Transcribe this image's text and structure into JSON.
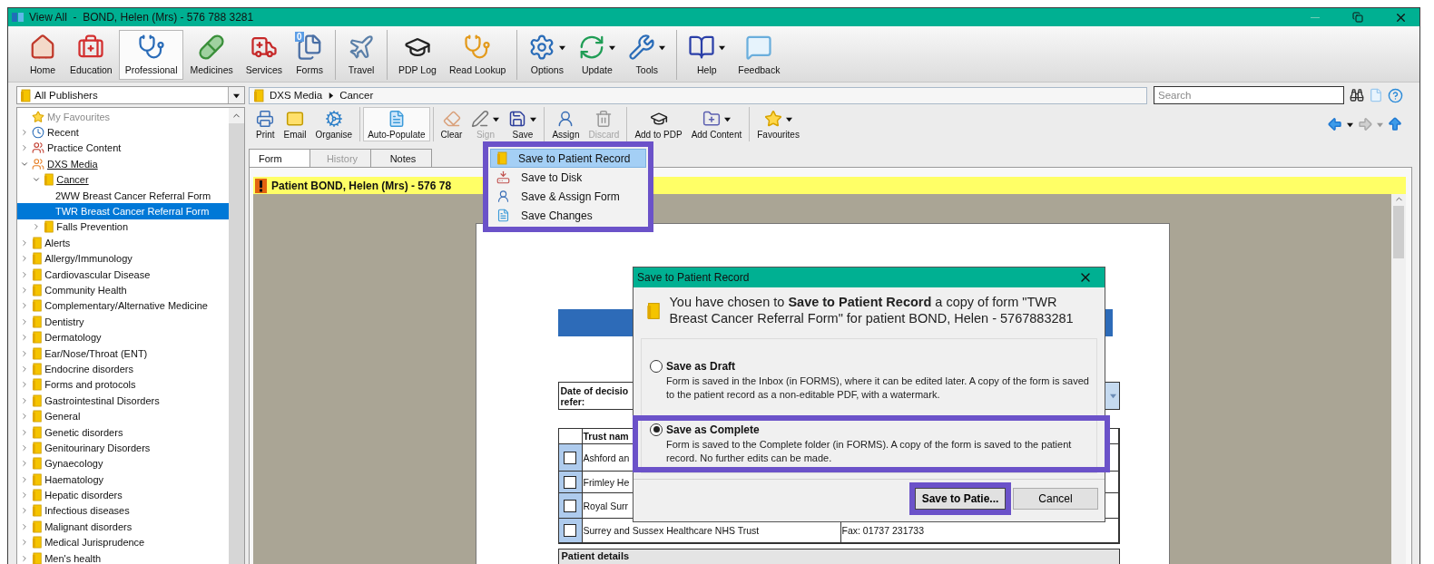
{
  "window": {
    "title": "View All  -  BOND, Helen (Mrs) - 576 788 3281"
  },
  "main_toolbar": {
    "groups": [
      [
        {
          "label": "Home",
          "kind": "home",
          "selected": false,
          "dropdown": false
        },
        {
          "label": "Education",
          "kind": "education",
          "selected": false,
          "dropdown": false
        },
        {
          "label": "Professional",
          "kind": "professional",
          "selected": true,
          "dropdown": false
        },
        {
          "label": "Medicines",
          "kind": "medicines",
          "selected": false,
          "dropdown": false
        },
        {
          "label": "Services",
          "kind": "services",
          "selected": false,
          "dropdown": false
        },
        {
          "label": "Forms",
          "kind": "forms",
          "selected": false,
          "dropdown": false,
          "badge": "0"
        }
      ],
      [
        {
          "label": "Travel",
          "kind": "travel",
          "selected": false,
          "dropdown": false
        }
      ],
      [
        {
          "label": "PDP Log",
          "kind": "pdp",
          "selected": false,
          "dropdown": false
        },
        {
          "label": "Read Lookup",
          "kind": "lookup",
          "selected": false,
          "dropdown": false
        }
      ],
      [
        {
          "label": "Options",
          "kind": "options",
          "selected": false,
          "dropdown": true
        },
        {
          "label": "Update",
          "kind": "update",
          "selected": false,
          "dropdown": true
        },
        {
          "label": "Tools",
          "kind": "tools",
          "selected": false,
          "dropdown": true
        }
      ],
      [
        {
          "label": "Help",
          "kind": "help",
          "selected": false,
          "dropdown": true
        },
        {
          "label": "Feedback",
          "kind": "feedback",
          "selected": false,
          "dropdown": false
        }
      ]
    ]
  },
  "sidebar": {
    "publisher": "All Publishers",
    "tree": [
      {
        "label": "My Favourites",
        "kind": "favourites",
        "selected": false,
        "disabled": true
      },
      {
        "label": "Recent",
        "kind": "recent",
        "expanded": false,
        "selected": false,
        "disabled": false
      },
      {
        "label": "Practice Content",
        "kind": "practice",
        "expanded": false,
        "selected": false,
        "disabled": false
      },
      {
        "label": "DXS Media",
        "kind": "publisher",
        "expanded": true,
        "selected": false,
        "disabled": false,
        "children": [
          {
            "label": "Cancer",
            "kind": "folder",
            "expanded": true,
            "selected": false,
            "disabled": false,
            "children": [
              {
                "label": "2WW Breast Cancer Referral Form",
                "selected": false,
                "disabled": false
              },
              {
                "label": "TWR Breast Cancer Referral Form",
                "selected": true,
                "disabled": false
              }
            ]
          },
          {
            "label": "Falls Prevention",
            "kind": "folder",
            "expanded": false,
            "selected": false,
            "disabled": false
          }
        ]
      },
      {
        "label": "Alerts",
        "kind": "folder",
        "expanded": false,
        "selected": false,
        "disabled": false
      },
      {
        "label": "Allergy/Immunology",
        "kind": "folder",
        "expanded": false,
        "selected": false,
        "disabled": false
      },
      {
        "label": "Cardiovascular Disease",
        "kind": "folder",
        "expanded": false,
        "selected": false,
        "disabled": false
      },
      {
        "label": "Community Health",
        "kind": "folder",
        "expanded": false,
        "selected": false,
        "disabled": false
      },
      {
        "label": "Complementary/Alternative Medicine",
        "kind": "folder",
        "expanded": false,
        "selected": false,
        "disabled": false
      },
      {
        "label": "Dentistry",
        "kind": "folder",
        "expanded": false,
        "selected": false,
        "disabled": false
      },
      {
        "label": "Dermatology",
        "kind": "folder",
        "expanded": false,
        "selected": false,
        "disabled": false
      },
      {
        "label": "Ear/Nose/Throat (ENT)",
        "kind": "folder",
        "expanded": false,
        "selected": false,
        "disabled": false
      },
      {
        "label": "Endocrine disorders",
        "kind": "folder",
        "expanded": false,
        "selected": false,
        "disabled": false
      },
      {
        "label": "Forms and protocols",
        "kind": "folder",
        "expanded": false,
        "selected": false,
        "disabled": false
      },
      {
        "label": "Gastrointestinal Disorders",
        "kind": "folder",
        "expanded": false,
        "selected": false,
        "disabled": false
      },
      {
        "label": "General",
        "kind": "folder",
        "expanded": false,
        "selected": false,
        "disabled": false
      },
      {
        "label": "Genetic disorders",
        "kind": "folder",
        "expanded": false,
        "selected": false,
        "disabled": false
      },
      {
        "label": "Genitourinary Disorders",
        "kind": "folder",
        "expanded": false,
        "selected": false,
        "disabled": false
      },
      {
        "label": "Gynaecology",
        "kind": "folder",
        "expanded": false,
        "selected": false,
        "disabled": false
      },
      {
        "label": "Haematology",
        "kind": "folder",
        "expanded": false,
        "selected": false,
        "disabled": false
      },
      {
        "label": "Hepatic disorders",
        "kind": "folder",
        "expanded": false,
        "selected": false,
        "disabled": false
      },
      {
        "label": "Infectious diseases",
        "kind": "folder",
        "expanded": false,
        "selected": false,
        "disabled": false
      },
      {
        "label": "Malignant disorders",
        "kind": "folder",
        "expanded": false,
        "selected": false,
        "disabled": false
      },
      {
        "label": "Medical Jurisprudence",
        "kind": "folder",
        "expanded": false,
        "selected": false,
        "disabled": false
      },
      {
        "label": "Men's health",
        "kind": "folder",
        "expanded": false,
        "selected": false,
        "disabled": false
      }
    ]
  },
  "breadcrumb": [
    "DXS Media",
    "Cancer"
  ],
  "search": {
    "placeholder": "Search"
  },
  "form_toolbar": {
    "groups": [
      [
        {
          "label": "Print",
          "kind": "print",
          "selected": false,
          "disabled": false,
          "dropdown": false
        },
        {
          "label": "Email",
          "kind": "email",
          "selected": false,
          "disabled": false,
          "dropdown": false
        },
        {
          "label": "Organise",
          "kind": "organise",
          "selected": false,
          "disabled": false,
          "dropdown": false
        }
      ],
      [
        {
          "label": "Auto-Populate",
          "kind": "autopopulate",
          "selected": true,
          "disabled": false,
          "dropdown": false
        }
      ],
      [
        {
          "label": "Clear",
          "kind": "clear",
          "selected": false,
          "disabled": false,
          "dropdown": false
        },
        {
          "label": "Sign",
          "kind": "sign",
          "selected": false,
          "disabled": true,
          "dropdown": true
        },
        {
          "label": "Save",
          "kind": "save",
          "selected": false,
          "disabled": false,
          "dropdown": true
        }
      ],
      [
        {
          "label": "Assign",
          "kind": "assign",
          "selected": false,
          "disabled": false,
          "dropdown": false
        },
        {
          "label": "Discard",
          "kind": "discard",
          "selected": false,
          "disabled": true,
          "dropdown": false
        }
      ],
      [
        {
          "label": "Add to PDP",
          "kind": "pdp",
          "selected": false,
          "disabled": false,
          "dropdown": false
        },
        {
          "label": "Add Content",
          "kind": "addcontent",
          "selected": false,
          "disabled": false,
          "dropdown": true
        }
      ],
      [
        {
          "label": "Favourites",
          "kind": "favourites",
          "selected": false,
          "disabled": false,
          "dropdown": true
        }
      ]
    ]
  },
  "tabs": [
    {
      "label": "Form",
      "selected": true,
      "disabled": false
    },
    {
      "label": "History",
      "selected": false,
      "disabled": true
    },
    {
      "label": "Notes",
      "selected": false,
      "disabled": false
    }
  ],
  "patient_banner": "Patient BOND, Helen (Mrs) - 576 78",
  "save_menu": {
    "highlighted": true,
    "items": [
      {
        "label": "Save to Patient Record",
        "kind": "record",
        "selected": true
      },
      {
        "label": "Save to Disk",
        "kind": "disk",
        "selected": false
      },
      {
        "label": "Save & Assign Form",
        "kind": "assign",
        "selected": false
      },
      {
        "label": "Save Changes",
        "kind": "changes",
        "selected": false
      }
    ]
  },
  "document": {
    "decision_label_lines": [
      "Date of decisio",
      "refer:"
    ],
    "trust_header": "Trust nam",
    "trust_rows": [
      {
        "name": "Ashford an",
        "fax": "",
        "checked": false
      },
      {
        "name": "Frimley He",
        "fax": "",
        "checked": false
      },
      {
        "name": "Royal Surr",
        "fax": "",
        "checked": false
      },
      {
        "name": "Surrey and Sussex Healthcare NHS Trust",
        "fax": "Fax: 01737 231733",
        "checked": false
      }
    ],
    "section_heading": "Patient details"
  },
  "dialog": {
    "title": "Save to Patient Record",
    "message": "You have chosen to **Save to Patient Record** a copy of form \"TWR Breast Cancer Referral Form\" for patient BOND, Helen - 5767883281",
    "options": [
      {
        "label": "Save as Draft",
        "description": "Form is saved in the Inbox (in FORMS), where it can be edited later. A copy of the form is saved to the patient record as a non-editable PDF, with a watermark.",
        "selected": false,
        "highlighted": false
      },
      {
        "label": "Save as Complete",
        "description": "Form is saved to the Complete folder (in FORMS). A copy of the form is saved to the patient record. No further edits can be made.",
        "selected": true,
        "highlighted": true
      }
    ],
    "buttons": [
      {
        "label": "Save to Patie...",
        "default": true,
        "highlighted": true
      },
      {
        "label": "Cancel",
        "default": false,
        "highlighted": false
      }
    ]
  }
}
